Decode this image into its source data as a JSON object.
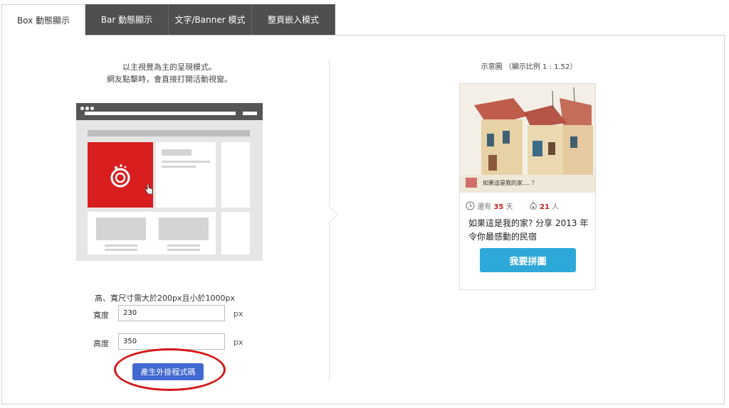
{
  "tabs": [
    {
      "label": "Box 動態顯示",
      "active": true
    },
    {
      "label": "Bar 動態顯示",
      "active": false
    },
    {
      "label": "文字/Banner 模式",
      "active": false
    },
    {
      "label": "整頁嵌入模式",
      "active": false
    }
  ],
  "left": {
    "description_line1": "以主視覺為主的呈現模式。",
    "description_line2": "網友點擊時，會直接打開活動視窗。",
    "size_note": "高、寬尺寸需大於200px且小於1000px",
    "width_label": "寬度",
    "width_value": "230",
    "width_unit": "px",
    "height_label": "高度",
    "height_value": "350",
    "height_unit": "px",
    "generate_button": "產生外掛程式碼"
  },
  "right": {
    "preview_caption": "示意圖 （顯示比例 1 : 1.52）",
    "card": {
      "days_prefix": "還有",
      "days_value": "35",
      "days_suffix": "天",
      "people_value": "21",
      "people_suffix": "人",
      "title": "如果這是我的家? 分享 2013 年令你最感動的民宿",
      "image_caption": "如果這是我的家.... ？",
      "join_button": "我要拼圖"
    }
  },
  "colors": {
    "tab_dark": "#4f4f4f",
    "red_tile": "#d81e1e",
    "generate_button": "#4169d1",
    "join_button": "#2ea8d8",
    "highlight_red": "#c82020"
  },
  "icons": [
    "clock-icon",
    "flame-icon",
    "cursor-hand-icon",
    "logo-swirl-icon",
    "arrow-right-icon"
  ]
}
